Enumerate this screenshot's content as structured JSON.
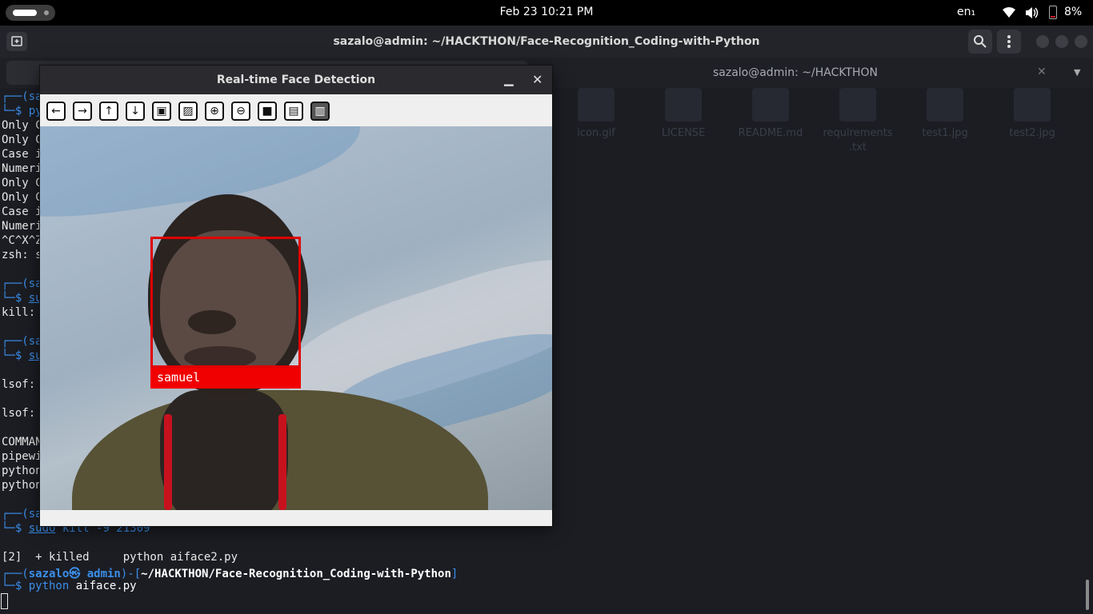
{
  "topbar": {
    "clock": "Feb 23  10:21 PM",
    "language": "en₁",
    "battery_percent": "8%",
    "battery_level": 0.08,
    "battery_color": "#c01c28"
  },
  "terminal": {
    "title": "sazalo@admin: ~/HACKTHON/Face-Recognition_Coding-with-Python",
    "second_tab": "sazalo@admin: ~/HACKTHON",
    "lines": {
      "l1": "└─$ py",
      "l2": "Only C",
      "l3": "Only C",
      "l4": "Case i",
      "l5": "Numeri",
      "l6": "Only C",
      "l7": "Only C",
      "l8": "Case i",
      "l9": "Numeri",
      "l10": "^C^X^Z",
      "l11": "zsh: s",
      "l12": "┌──(sa",
      "l13": "su",
      "l14": "kill: ",
      "l15": "┌──(sa",
      "l16": "su",
      "l17": "lsof: ",
      "l18": "lsof: ",
      "l19": "COMMAN",
      "l20": "pipewi",
      "l21": "python",
      "l22": "python",
      "l23": "┌──(sa",
      "l24_cmd": "sudo",
      "l24_rest": " kill -9 21309",
      "l25": "[2]  + killed     python aiface2.py",
      "l26_a": "┌──(",
      "l26_user": "sazalo㉿ admin",
      "l26_b": ")-[",
      "l26_path": "~/HACKTHON/Face-Recognition_Coding-with-Python",
      "l26_c": "]",
      "l27_prompt": "└─$ ",
      "l27_cmd": "python",
      "l27_arg": " aiface.py",
      "prompt_top": "┌──(sa",
      "prompt_bot": "└─$ "
    }
  },
  "desktop_files": [
    {
      "name": "icon.gif"
    },
    {
      "name": "LICENSE"
    },
    {
      "name": "README.md"
    },
    {
      "name": "requirements\n.txt"
    },
    {
      "name": "test1.jpg"
    },
    {
      "name": "test2.jpg"
    }
  ],
  "face_window": {
    "title": "Real-time Face Detection",
    "toolbar": [
      {
        "icon": "arrow-left-icon",
        "glyph": "←"
      },
      {
        "icon": "arrow-right-icon",
        "glyph": "→"
      },
      {
        "icon": "arrow-up-icon",
        "glyph": "↑"
      },
      {
        "icon": "arrow-down-icon",
        "glyph": "↓"
      },
      {
        "icon": "image-icon",
        "glyph": "▣"
      },
      {
        "icon": "image-properties-icon",
        "glyph": "▨"
      },
      {
        "icon": "zoom-in-icon",
        "glyph": "⊕"
      },
      {
        "icon": "zoom-out-icon",
        "glyph": "⊖"
      },
      {
        "icon": "save-icon",
        "glyph": "■"
      },
      {
        "icon": "clipboard-icon",
        "glyph": "▤"
      },
      {
        "icon": "properties-icon",
        "glyph": "▥"
      }
    ],
    "detected_name": "samuel",
    "box_color": "#e00000"
  }
}
